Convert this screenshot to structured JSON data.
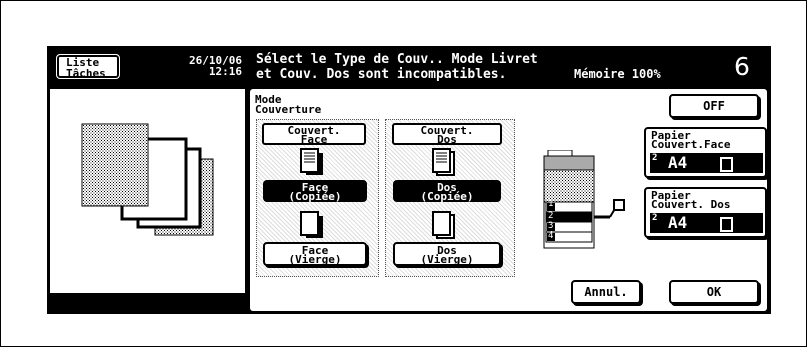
{
  "header": {
    "job_list_label": "Liste\nTâches",
    "date": "26/10/06",
    "time": "12:16",
    "message_line1": "Sélect le Type de Couv.. Mode Livret",
    "message_line2": "et Couv. Dos sont incompatibles.",
    "memory": "Mémoire 100%",
    "copy_count": "6"
  },
  "cover_mode": {
    "title": "Mode\nCouverture",
    "off_label": "OFF",
    "front_group": {
      "label": "Couvert.\nFace",
      "copied_label": "Face\n(Copiée)",
      "blank_label": "Face\n(Vierge)",
      "selected": "copied"
    },
    "back_group": {
      "label": "Couvert.\nDos",
      "copied_label": "Dos\n(Copiée)",
      "blank_label": "Dos\n(Vierge)",
      "selected": "copied"
    },
    "paper_front": {
      "label": "Papier\nCouvert.Face",
      "tray": "2",
      "size": "A4"
    },
    "paper_back": {
      "label": "Papier\nCouvert. Dos",
      "tray": "2",
      "size": "A4"
    },
    "trays": [
      "1",
      "2",
      "3",
      "4"
    ],
    "selected_tray": "2"
  },
  "footer": {
    "cancel_label": "Annul.",
    "ok_label": "OK"
  },
  "colors": {
    "panel": "#000000",
    "selected": "#000000",
    "background": "#ffffff"
  }
}
